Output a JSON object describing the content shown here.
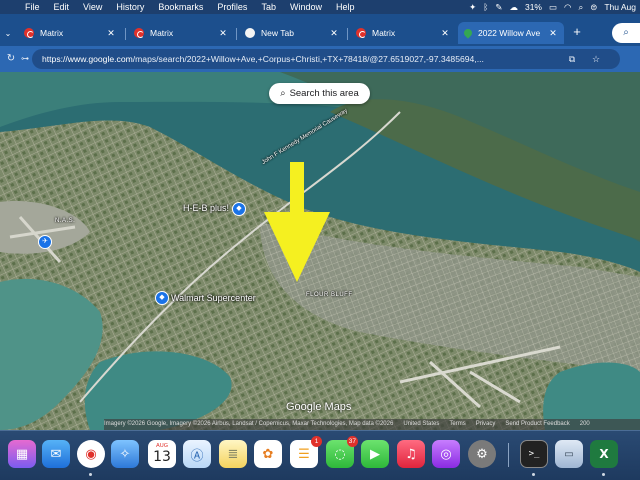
{
  "menubar": {
    "app_menu": [
      "File",
      "Edit",
      "View",
      "History",
      "Bookmarks",
      "Profiles",
      "Tab",
      "Window",
      "Help"
    ],
    "battery": "31%",
    "clock": "Thu Aug"
  },
  "tabs": [
    {
      "label": "Matrix",
      "favicon": "matrix-icon"
    },
    {
      "label": "Matrix",
      "favicon": "matrix-icon"
    },
    {
      "label": "New Tab",
      "favicon": "chrome-icon"
    },
    {
      "label": "Matrix",
      "favicon": "matrix-icon"
    },
    {
      "label": "2022 Willow Ave",
      "favicon": "google-maps-icon",
      "active": true
    }
  ],
  "toolbar": {
    "url_host": "https://www.google.com",
    "url_path": "/maps/search/2022+Willow+Ave,+Corpus+Christi,+TX+78418/@27.6519027,-97.3485694,..."
  },
  "map": {
    "search_area_label": "Search this area",
    "places": {
      "heb": "H-E-B plus!",
      "walmart": "Walmart Supercenter",
      "flour_bluff": "FLOUR BLUFF",
      "nas": "N.A.S.",
      "causeway": "John F Kennedy Memorial Causeway"
    },
    "google_logo": "Google Maps",
    "attribution": "Imagery ©2026 Google, Imagery ©2026 Airbus, Landsat / Copernicus, Maxar Technologies, Map data ©2026",
    "footer_links": [
      "United States",
      "Terms",
      "Privacy",
      "Send Product Feedback",
      "200"
    ]
  },
  "dock": {
    "calendar_month": "AUG",
    "calendar_day": "13",
    "reminders_badge": "1",
    "messages_badge": "37"
  },
  "colors": {
    "menubar": "#1d3f6e",
    "tabstrip": "#1c4f8d",
    "toolbar": "#2c68b3",
    "arrow": "#f5f020"
  }
}
